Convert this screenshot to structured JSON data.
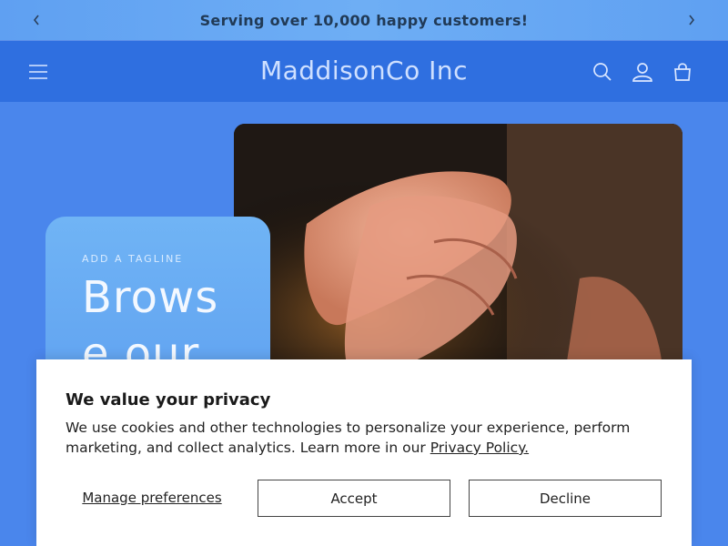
{
  "announcement": {
    "text": "Serving over 10,000 happy customers!"
  },
  "header": {
    "brand": "MaddisonCo Inc",
    "icons": [
      "menu-icon",
      "search-icon",
      "account-icon",
      "cart-icon"
    ]
  },
  "hero": {
    "tagline": "ADD A TAGLINE",
    "title": "Browse our"
  },
  "cookie_banner": {
    "title": "We value your privacy",
    "body": "We use cookies and other technologies to personalize your experience, perform marketing, and collect analytics. Learn more in our ",
    "policy_link": "Privacy Policy.",
    "manage_label": "Manage preferences",
    "accept_label": "Accept",
    "decline_label": "Decline"
  },
  "colors": {
    "announcement_bg": "#6eaef4",
    "header_bg": "#2f6fe0",
    "hero_bg": "#4a86ec",
    "card_bg": "#70b4f5"
  }
}
